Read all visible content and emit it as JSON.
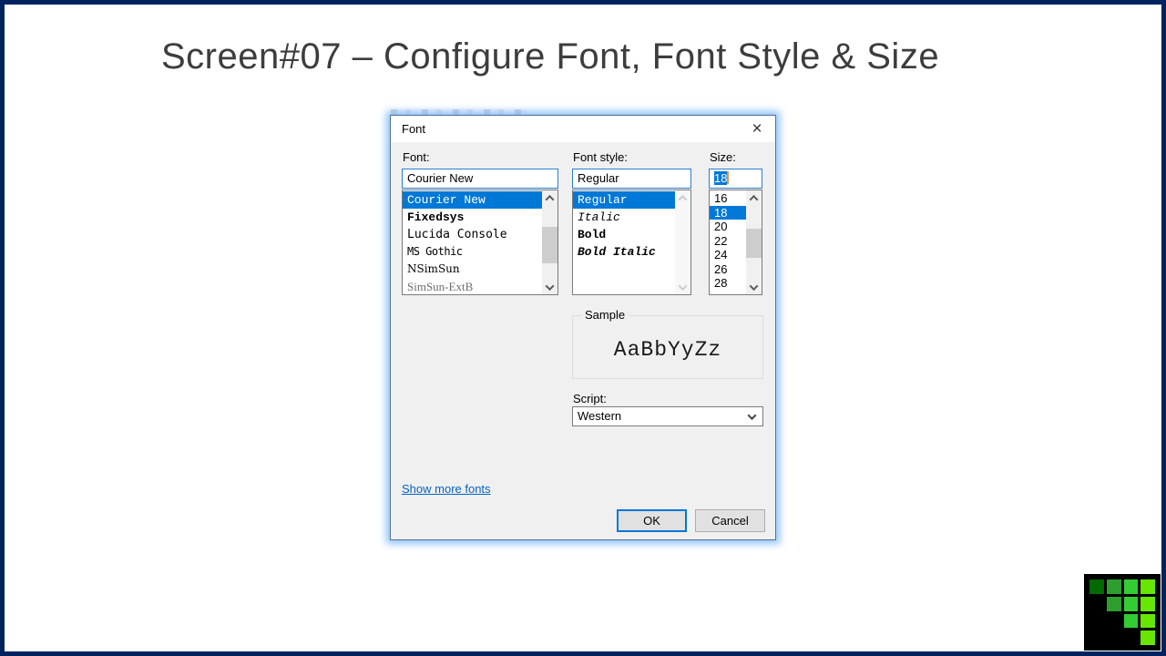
{
  "slide": {
    "title": "Screen#07 – Configure Font, Font Style & Size"
  },
  "dialog": {
    "title": "Font",
    "close_glyph": "×",
    "font": {
      "label": "Font:",
      "value": "Courier New",
      "items": [
        {
          "label": "Courier New",
          "selected": true,
          "font_class": "courier"
        },
        {
          "label": "Fixedsys",
          "font_class": "fixedsys"
        },
        {
          "label": "Lucida Console",
          "font_class": "lucida"
        },
        {
          "label": "MS Gothic",
          "font_class": "msgothic"
        },
        {
          "label": "NSimSun",
          "font_class": "nsimsun"
        },
        {
          "label": "SimSun-ExtB",
          "font_class": "simsunextb"
        }
      ]
    },
    "font_style": {
      "label": "Font style:",
      "value": "Regular",
      "items": [
        {
          "label": "Regular",
          "selected": true,
          "font_class": "regular"
        },
        {
          "label": "Italic",
          "font_class": "italic"
        },
        {
          "label": "Bold",
          "font_class": "bold"
        },
        {
          "label": "Bold Italic",
          "font_class": "bolditalic"
        }
      ]
    },
    "size": {
      "label": "Size:",
      "value": "18",
      "items": [
        {
          "label": "16"
        },
        {
          "label": "18",
          "selected": true
        },
        {
          "label": "20"
        },
        {
          "label": "22"
        },
        {
          "label": "24"
        },
        {
          "label": "26"
        },
        {
          "label": "28"
        }
      ]
    },
    "sample": {
      "label": "Sample",
      "text": "AaBbYyZz"
    },
    "script": {
      "label": "Script:",
      "value": "Western"
    },
    "link": "Show more fonts",
    "ok": "OK",
    "cancel": "Cancel",
    "selection_color": "#0078d7"
  },
  "logo": {
    "colors": [
      "#006b00",
      "#2e9e2e",
      "#33cc33",
      "#66e600"
    ],
    "grid": [
      [
        1,
        2,
        3,
        4
      ],
      [
        0,
        2,
        3,
        4
      ],
      [
        0,
        0,
        3,
        4
      ],
      [
        0,
        0,
        0,
        4
      ]
    ]
  }
}
